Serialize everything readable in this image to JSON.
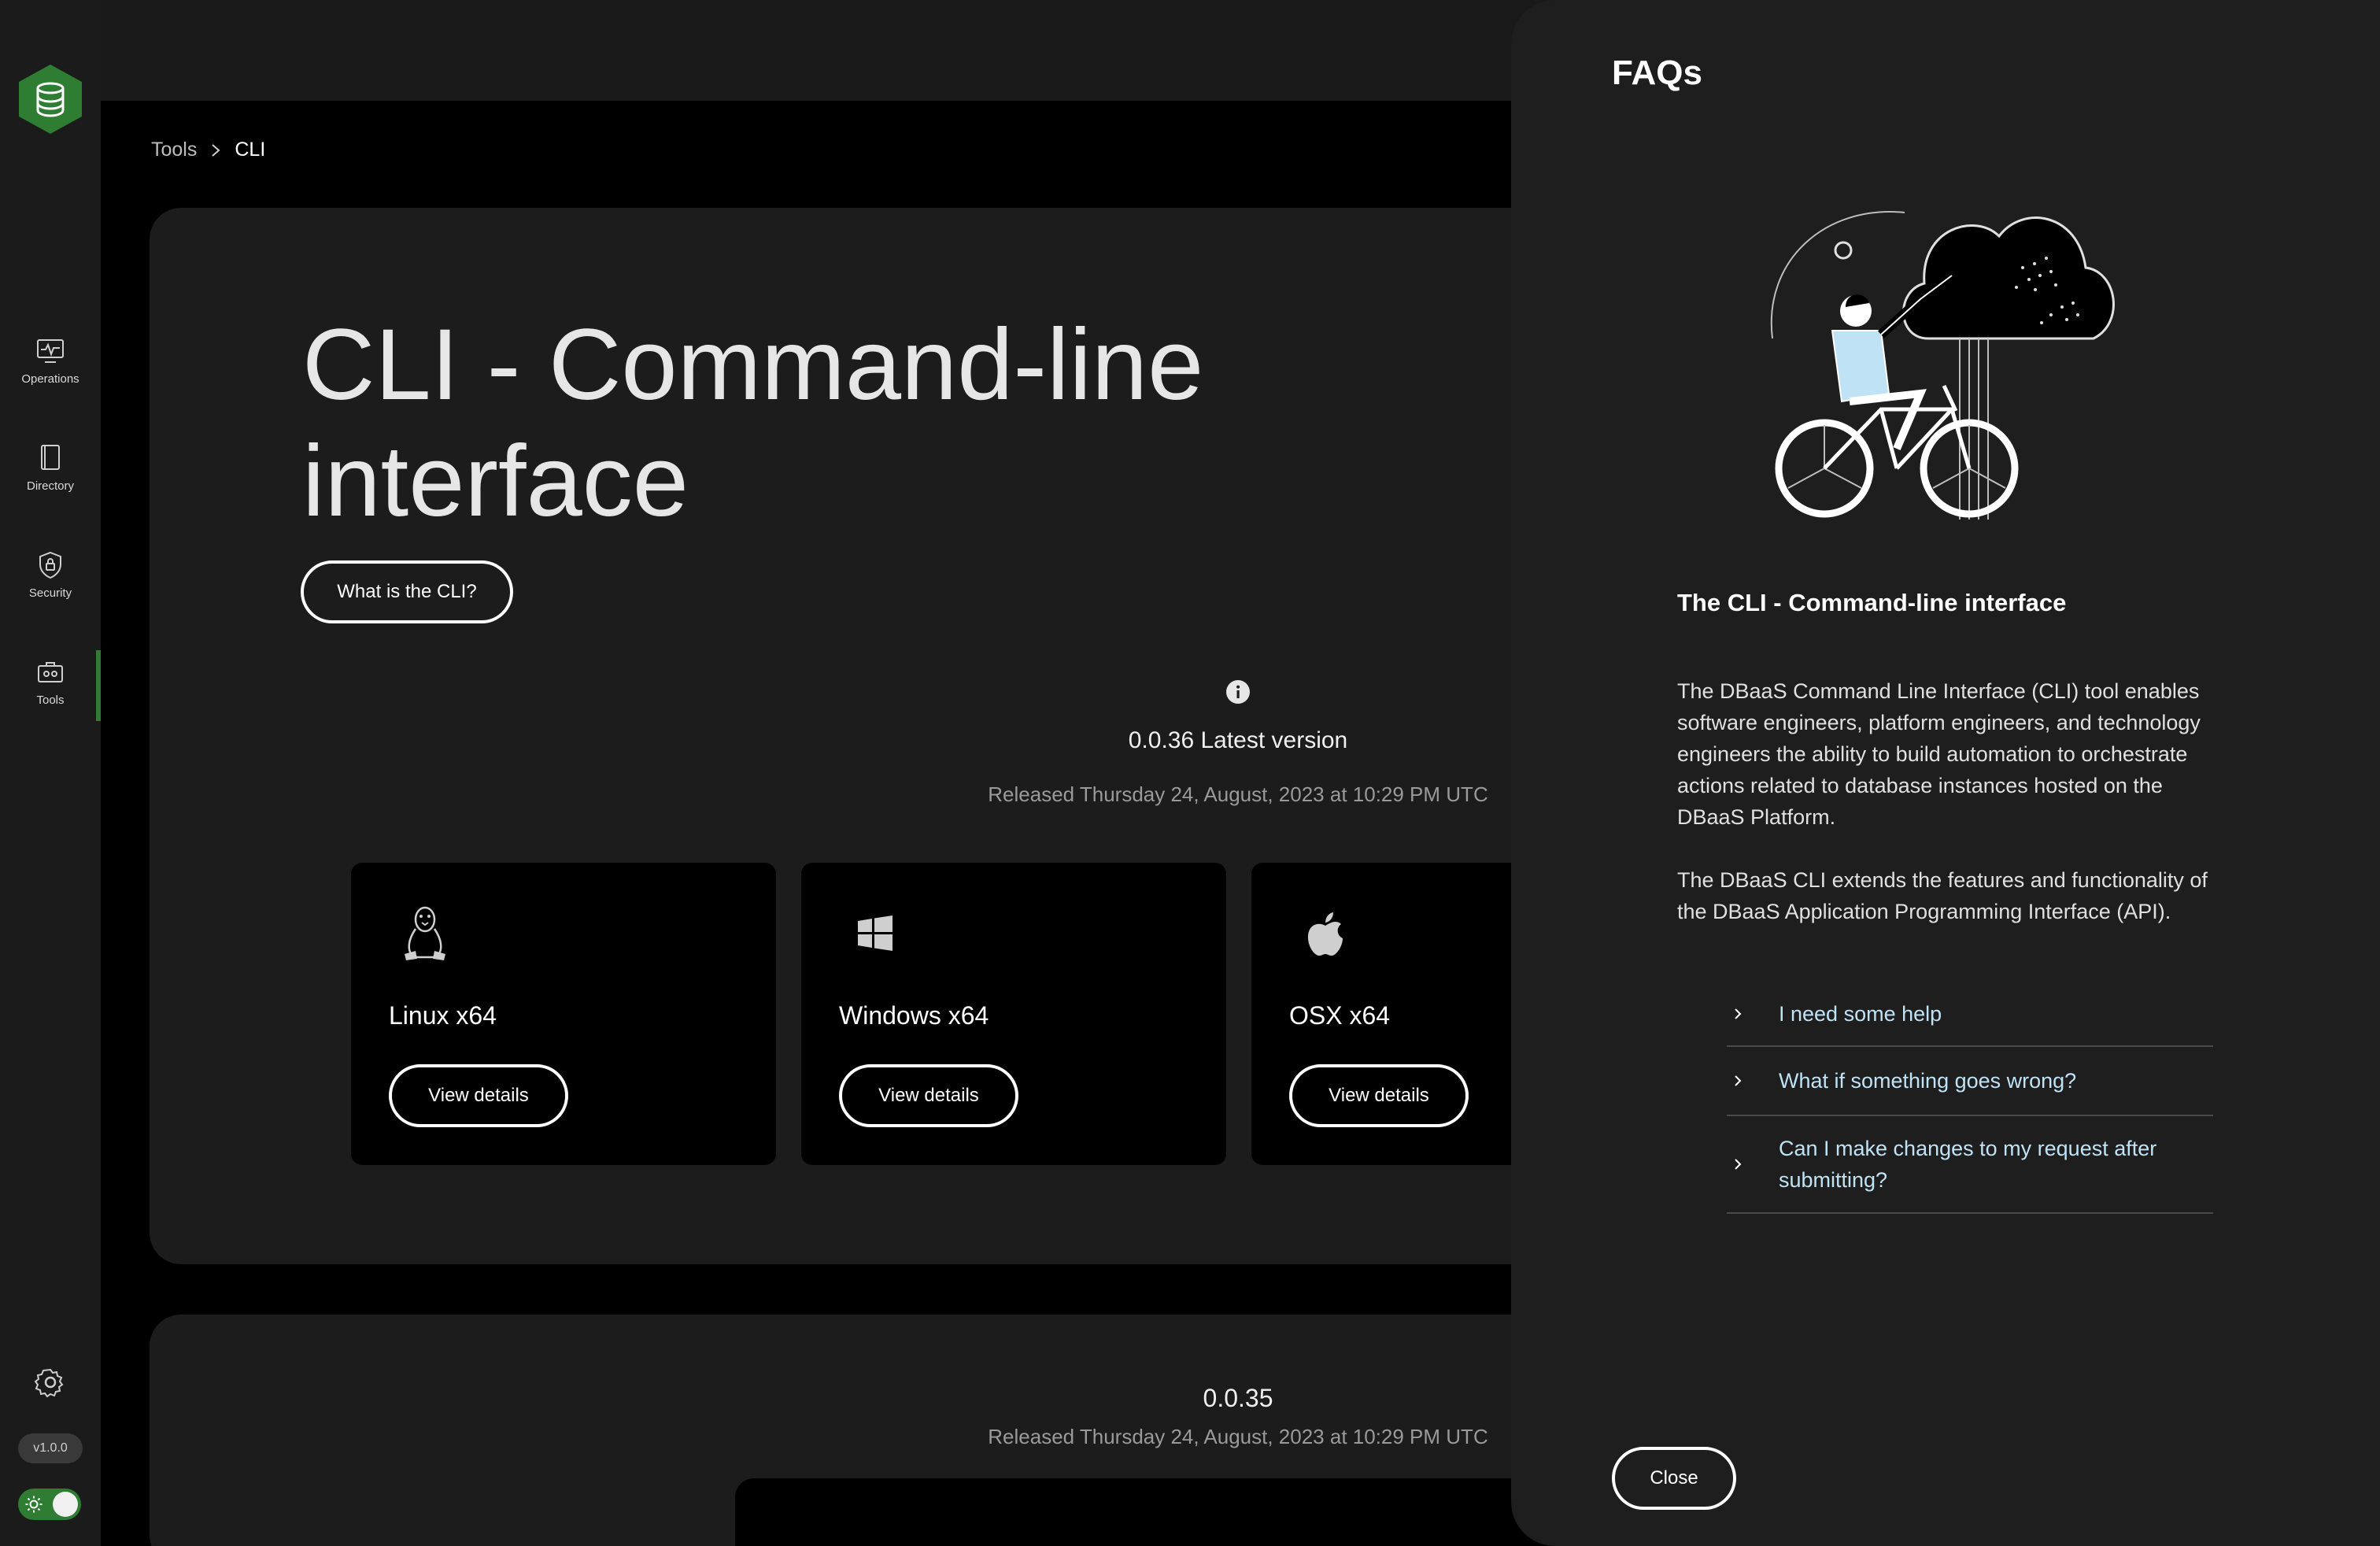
{
  "sidebar": {
    "items": [
      {
        "label": "Operations"
      },
      {
        "label": "Directory"
      },
      {
        "label": "Security"
      },
      {
        "label": "Tools"
      }
    ],
    "version": "v1.0.0",
    "accent": "#2e7d32"
  },
  "breadcrumb": {
    "parent": "Tools",
    "current": "CLI"
  },
  "hero": {
    "title": "CLI - Command-line interface",
    "what_is_button": "What is the CLI?"
  },
  "latest": {
    "version_label": "0.0.36 Latest version",
    "released": "Released Thursday 24, August, 2023 at 10:29 PM UTC"
  },
  "downloads": [
    {
      "os": "Linux x64",
      "icon": "linux-icon",
      "button": "View details"
    },
    {
      "os": "Windows x64",
      "icon": "windows-icon",
      "button": "View details"
    },
    {
      "os": "OSX x64",
      "icon": "apple-icon",
      "button": "View details"
    }
  ],
  "previous": {
    "version_label": "0.0.35",
    "released": "Released Thursday 24, August, 2023 at 10:29 PM UTC"
  },
  "faq": {
    "title": "FAQs",
    "subtitle": "The CLI - Command-line interface",
    "paragraph1": "The DBaaS Command Line Interface (CLI) tool enables software engineers, platform engineers, and technology engineers the ability to build automation to orchestrate actions related to database instances hosted on the DBaaS Platform.",
    "paragraph2": "The DBaaS CLI extends the features and functionality of the DBaaS Application Programming Interface (API).",
    "questions": [
      "I need some help",
      "What if something goes wrong?",
      "Can I make changes to my request after submitting?"
    ],
    "close_button": "Close",
    "link_color": "#bfe3f5"
  }
}
